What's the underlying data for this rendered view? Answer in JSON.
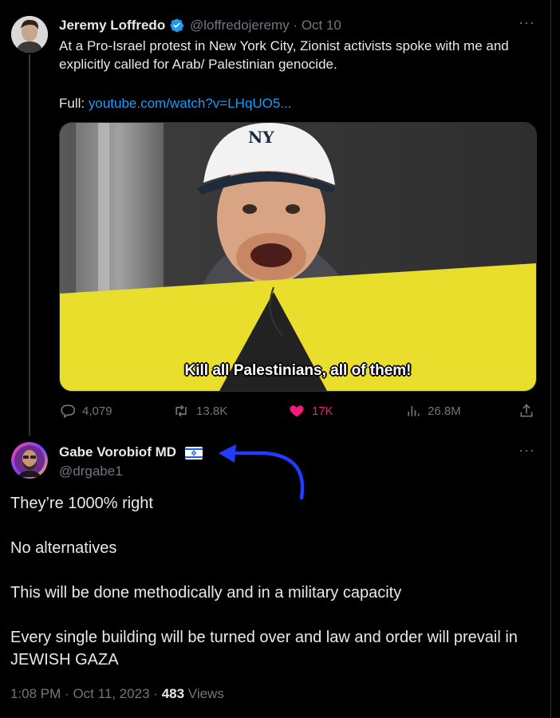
{
  "original_tweet": {
    "author_name": "Jeremy Loffredo",
    "handle": "@loffredojeremy",
    "separator": "·",
    "date": "Oct 10",
    "text": "At a Pro-Israel protest in New York City, Zionist activists spoke with me and explicitly called for Arab/ Palestinian genocide.",
    "full_label": "Full:",
    "full_link": "youtube.com/watch?v=LHqUO5...",
    "video_caption": "Kill all Palestinians, all of them!",
    "cap_logo": "NY",
    "stats": {
      "replies": "4,079",
      "retweets": "13.8K",
      "likes": "17K",
      "views": "26.8M"
    }
  },
  "reply_tweet": {
    "author_name": "Gabe Vorobiof MD",
    "handle": "@drgabe1",
    "paragraphs": [
      "They’re 1000% right",
      "No alternatives",
      "This will be done methodically and in a military capacity",
      "Every single building will be turned over and law and order will prevail in JEWISH GAZA"
    ],
    "time": "1:08 PM",
    "date": "Oct 11, 2023",
    "separator": "·",
    "views_count": "483",
    "views_label": "Views"
  },
  "more_label": "···",
  "colors": {
    "background": "#000000",
    "text": "#e7e9ea",
    "muted": "#71767b",
    "link": "#1d9bf0",
    "like": "#f91880",
    "verified": "#1d9bf0",
    "annotation_arrow": "#1f3cff"
  },
  "icons": [
    "verified-badge-icon",
    "reply-icon",
    "retweet-icon",
    "like-icon",
    "views-icon",
    "share-icon",
    "israel-flag-icon",
    "annotation-arrow"
  ]
}
